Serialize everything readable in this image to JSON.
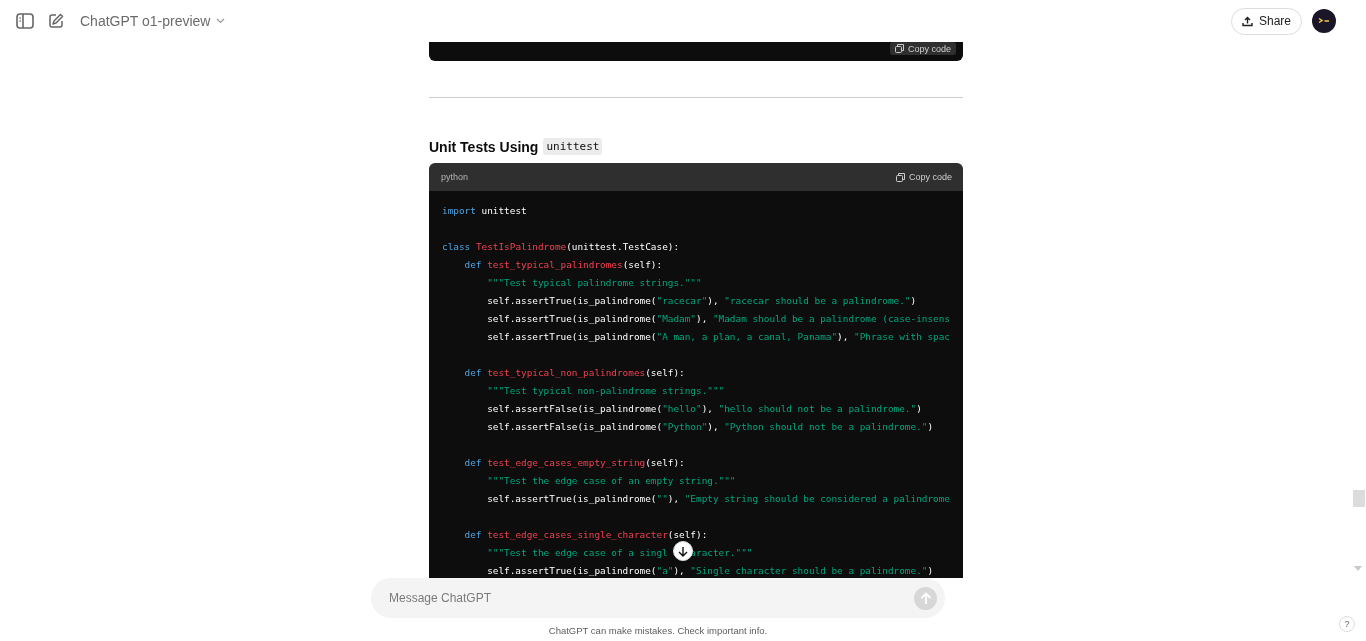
{
  "header": {
    "model": "ChatGPT o1-preview",
    "share": "Share"
  },
  "previous_code": {
    "copy": "Copy code"
  },
  "heading": {
    "text": "Unit Tests Using",
    "code": "unittest"
  },
  "code_block": {
    "language": "python",
    "copy": "Copy code",
    "lines": [
      {
        "kind": "code",
        "tokens": [
          {
            "kind": "kw",
            "text": "import"
          },
          {
            "kind": "plain",
            "text": " unittest"
          }
        ]
      },
      {
        "kind": "blank"
      },
      {
        "kind": "code",
        "tokens": [
          {
            "kind": "kw",
            "text": "class "
          },
          {
            "kind": "fn",
            "text": "TestIsPalindrome"
          },
          {
            "kind": "plain",
            "text": "(unittest.TestCase):"
          }
        ]
      },
      {
        "kind": "code",
        "tokens": [
          {
            "kind": "kw",
            "text": "    def "
          },
          {
            "kind": "fn",
            "text": "test_typical_palindromes"
          },
          {
            "kind": "plain",
            "text": "(self):"
          }
        ]
      },
      {
        "kind": "code",
        "tokens": [
          {
            "kind": "str",
            "text": "        \"\"\"Test typical palindrome strings.\"\"\""
          }
        ]
      },
      {
        "kind": "code",
        "tokens": [
          {
            "kind": "plain",
            "text": "        self.assertTrue(is_palindrome("
          },
          {
            "kind": "str",
            "text": "\"racecar\""
          },
          {
            "kind": "plain",
            "text": "), "
          },
          {
            "kind": "str",
            "text": "\"racecar should be a palindrome.\""
          },
          {
            "kind": "plain",
            "text": ")"
          }
        ]
      },
      {
        "kind": "code",
        "tokens": [
          {
            "kind": "plain",
            "text": "        self.assertTrue(is_palindrome("
          },
          {
            "kind": "str",
            "text": "\"Madam\""
          },
          {
            "kind": "plain",
            "text": "), "
          },
          {
            "kind": "str",
            "text": "\"Madam should be a palindrome (case-insens"
          }
        ]
      },
      {
        "kind": "code",
        "tokens": [
          {
            "kind": "plain",
            "text": "        self.assertTrue(is_palindrome("
          },
          {
            "kind": "str",
            "text": "\"A man, a plan, a canal, Panama\""
          },
          {
            "kind": "plain",
            "text": "), "
          },
          {
            "kind": "str",
            "text": "\"Phrase with spac"
          }
        ]
      },
      {
        "kind": "blank"
      },
      {
        "kind": "code",
        "tokens": [
          {
            "kind": "kw",
            "text": "    def "
          },
          {
            "kind": "fn",
            "text": "test_typical_non_palindromes"
          },
          {
            "kind": "plain",
            "text": "(self):"
          }
        ]
      },
      {
        "kind": "code",
        "tokens": [
          {
            "kind": "str",
            "text": "        \"\"\"Test typical non-palindrome strings.\"\"\""
          }
        ]
      },
      {
        "kind": "code",
        "tokens": [
          {
            "kind": "plain",
            "text": "        self.assertFalse(is_palindrome("
          },
          {
            "kind": "str",
            "text": "\"hello\""
          },
          {
            "kind": "plain",
            "text": "), "
          },
          {
            "kind": "str",
            "text": "\"hello should not be a palindrome.\""
          },
          {
            "kind": "plain",
            "text": ")"
          }
        ]
      },
      {
        "kind": "code",
        "tokens": [
          {
            "kind": "plain",
            "text": "        self.assertFalse(is_palindrome("
          },
          {
            "kind": "str",
            "text": "\"Python\""
          },
          {
            "kind": "plain",
            "text": "), "
          },
          {
            "kind": "str",
            "text": "\"Python should not be a palindrome.\""
          },
          {
            "kind": "plain",
            "text": ")"
          }
        ]
      },
      {
        "kind": "blank"
      },
      {
        "kind": "code",
        "tokens": [
          {
            "kind": "kw",
            "text": "    def "
          },
          {
            "kind": "fn",
            "text": "test_edge_cases_empty_string"
          },
          {
            "kind": "plain",
            "text": "(self):"
          }
        ]
      },
      {
        "kind": "code",
        "tokens": [
          {
            "kind": "str",
            "text": "        \"\"\"Test the edge case of an empty string.\"\"\""
          }
        ]
      },
      {
        "kind": "code",
        "tokens": [
          {
            "kind": "plain",
            "text": "        self.assertTrue(is_palindrome("
          },
          {
            "kind": "str",
            "text": "\"\""
          },
          {
            "kind": "plain",
            "text": "), "
          },
          {
            "kind": "str",
            "text": "\"Empty string should be considered a palindrome"
          }
        ]
      },
      {
        "kind": "blank"
      },
      {
        "kind": "code",
        "tokens": [
          {
            "kind": "kw",
            "text": "    def "
          },
          {
            "kind": "fn",
            "text": "test_edge_cases_single_character"
          },
          {
            "kind": "plain",
            "text": "(self):"
          }
        ]
      },
      {
        "kind": "split",
        "tokens": [
          {
            "kind": "str",
            "text": "        \"\"\"Test the edge case of a singl"
          },
          {
            "kind": "str",
            "text": "aracter.\"\"\""
          }
        ]
      },
      {
        "kind": "code",
        "tokens": [
          {
            "kind": "plain",
            "text": "        self.assertTrue(is_palindrome("
          },
          {
            "kind": "str",
            "text": "\"a\""
          },
          {
            "kind": "plain",
            "text": "), "
          },
          {
            "kind": "str",
            "text": "\"Single character should be a palindrome.\""
          },
          {
            "kind": "plain",
            "text": ")"
          }
        ]
      }
    ]
  },
  "composer": {
    "placeholder": "Message ChatGPT"
  },
  "disclaimer": "ChatGPT can make mistakes. Check important info.",
  "help": "?"
}
